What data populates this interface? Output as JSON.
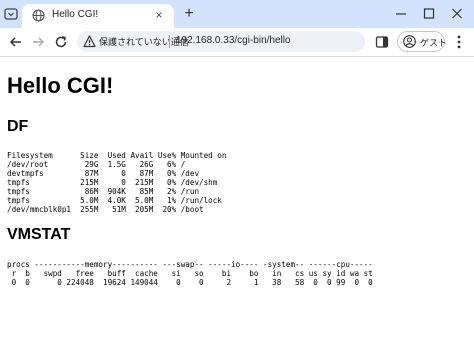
{
  "browser": {
    "tab": {
      "title": "Hello CGI!",
      "close_glyph": "×"
    },
    "new_tab_glyph": "+",
    "address": {
      "security_label": "保護されていない通信",
      "url": "192.168.0.33/cgi-bin/hello"
    },
    "profile_label": "ゲスト",
    "icons": {
      "tab_switch": "tab-switch-icon",
      "favicon": "globe-icon",
      "minimize": "minimize-icon",
      "maximize": "maximize-icon",
      "close": "close-icon",
      "back": "back-arrow-icon",
      "forward": "forward-arrow-icon",
      "reload": "reload-icon",
      "warning": "warning-icon",
      "side_panel": "side-panel-icon",
      "profile": "person-icon",
      "menu": "kebab-menu-icon"
    },
    "colors": {
      "tab_strip": "#d3e3fd",
      "omnibox": "#eef1f7"
    }
  },
  "page": {
    "title": "Hello CGI!",
    "df": {
      "heading": "DF",
      "header": "Filesystem      Size  Used Avail Use% Mounted on",
      "rows": [
        "/dev/root        29G  1.5G   26G   6% /",
        "devtmpfs         87M     0   87M   0% /dev",
        "tmpfs           215M     0  215M   0% /dev/shm",
        "tmpfs            86M  904K   85M   2% /run",
        "tmpfs           5.0M  4.0K  5.0M   1% /run/lock",
        "/dev/mmcblk0p1  255M   51M  205M  20% /boot"
      ]
    },
    "vmstat": {
      "heading": "VMSTAT",
      "header1": "procs -----------memory---------- ---swap-- -----io---- -system-- ------cpu-----",
      "header2": " r  b   swpd   free   buff  cache   si   so    bi    bo   in   cs us sy id wa st",
      "row": " 0  0      0 224048  19624 149044    0    0     2     1   38   58  0  0 99  0  0"
    }
  }
}
